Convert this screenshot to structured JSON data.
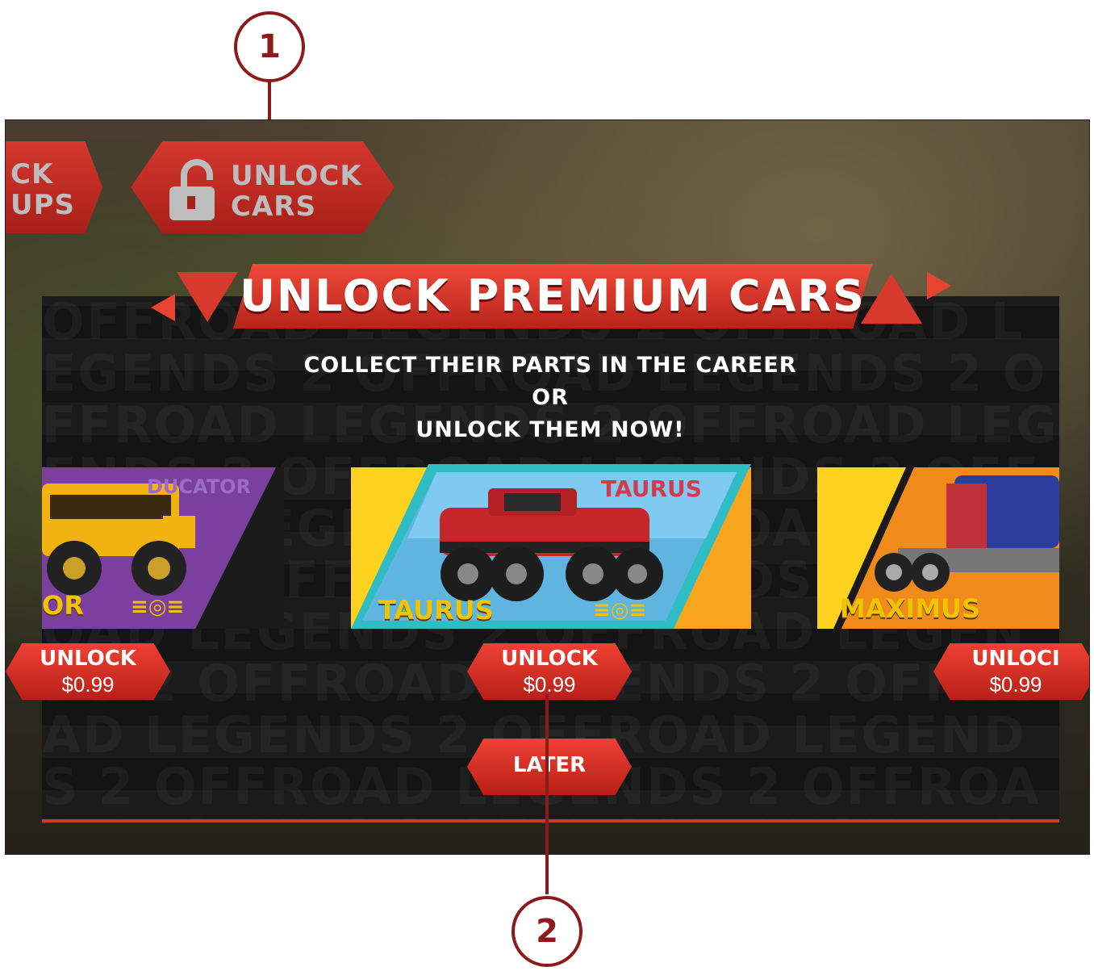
{
  "top_bar": {
    "left_button": {
      "line1": "CK",
      "line2": "UPS"
    },
    "unlock_cars_button": {
      "line1": "UNLOCK",
      "line2": "CARS",
      "icon": "padlock-open-icon"
    }
  },
  "modal": {
    "title": "UNLOCK PREMIUM CARS",
    "subtitle_line1": "COLLECT THEIR PARTS IN THE CAREER",
    "subtitle_line2": "OR",
    "subtitle_line3": "UNLOCK THEM NOW!",
    "watermark": "OFFROAD LEGENDS 2",
    "cars": [
      {
        "name": "OR",
        "badge_name": "DUCATOR",
        "unlock_label": "UNLOCK",
        "price": "$0.99"
      },
      {
        "name": "TAURUS",
        "badge_name": "TAURUS",
        "unlock_label": "UNLOCK",
        "price": "$0.99",
        "selected": true
      },
      {
        "name": "MAXIMUS",
        "unlock_label": "UNLOCI",
        "price": "$0.99"
      }
    ],
    "later_label": "LATER"
  },
  "callouts": {
    "first": "1",
    "second": "2"
  },
  "colors": {
    "accent_red": "#d4382e",
    "callout": "#8b1a1a",
    "selected_border": "#2fbcc4",
    "gold_text": "#f0c400"
  }
}
